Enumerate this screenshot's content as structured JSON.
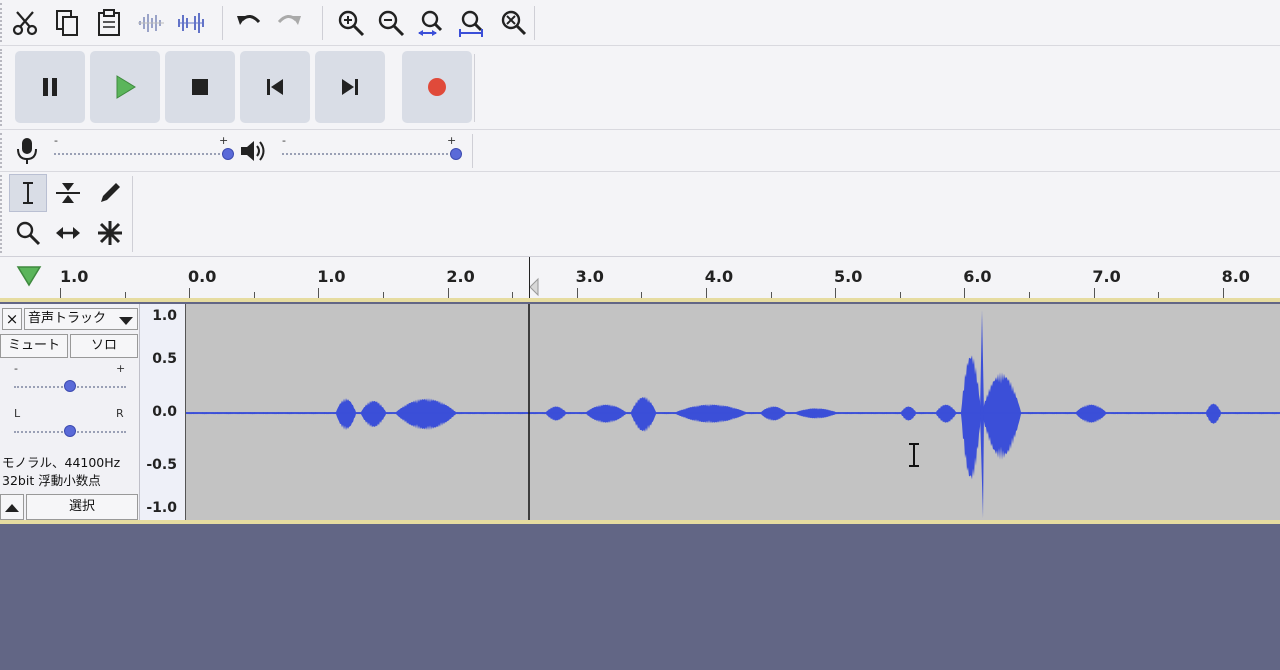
{
  "edit_toolbar": {
    "buttons": [
      "cut-icon",
      "copy-icon",
      "paste-icon",
      "trim-icon",
      "silence-icon",
      "undo-icon",
      "redo-icon",
      "zoom-in-icon",
      "zoom-out-icon",
      "fit-selection-icon",
      "fit-project-icon",
      "zoom-toggle-icon"
    ]
  },
  "transport": {
    "buttons": [
      "pause-icon",
      "play-icon",
      "stop-icon",
      "skip-start-icon",
      "skip-end-icon",
      "record-icon"
    ],
    "colors": {
      "play": "#5bb55b",
      "record": "#e04a3a",
      "icon": "#222222"
    }
  },
  "meters": {
    "record_minus": "-",
    "record_plus": "+",
    "play_minus": "-",
    "play_plus": "+",
    "record_level": 1.0,
    "play_level": 1.0
  },
  "tools": [
    "selection-tool-icon",
    "envelope-tool-icon",
    "draw-tool-icon",
    "zoom-tool-icon",
    "time-shift-tool-icon",
    "multi-tool-icon"
  ],
  "timeline": {
    "labels": [
      "1.0",
      "0.0",
      "1.0",
      "2.0",
      "3.0",
      "4.0",
      "5.0",
      "6.0",
      "7.0",
      "8.0"
    ],
    "play_head_seconds": 2.6
  },
  "track": {
    "close": "×",
    "name": "音声トラック",
    "mute": "ミュート",
    "solo": "ソロ",
    "gain_minus": "-",
    "gain_plus": "+",
    "pan_left": "L",
    "pan_right": "R",
    "gain_level": 0.5,
    "pan_level": 0.5,
    "format_line1": "モノラル、44100Hz",
    "format_line2": "32bit 浮動小数点",
    "select": "選択",
    "y_labels": [
      "1.0",
      "0.5",
      "0.0",
      "-0.5",
      "-1.0"
    ],
    "wave_color": "#3b4fd8"
  }
}
